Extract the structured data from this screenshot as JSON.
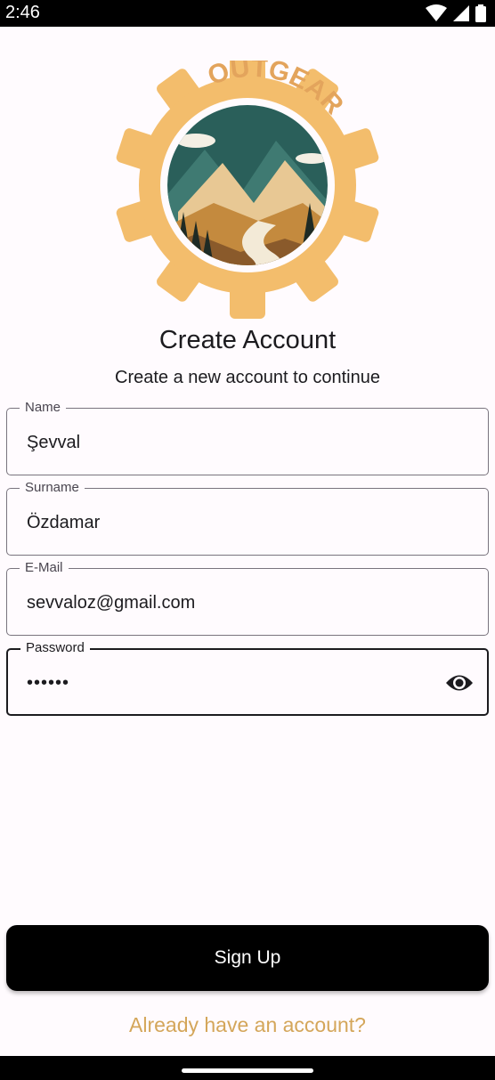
{
  "status_bar": {
    "time": "2:46",
    "icons": [
      "wifi-icon",
      "signal-icon",
      "battery-icon"
    ]
  },
  "logo": {
    "brand": "OUTGEAR",
    "colors": {
      "gear": "#f3bd6c",
      "sky": "#2a5f5a",
      "text": "#e3a45c"
    }
  },
  "header": {
    "title": "Create Account",
    "subtitle": "Create a new account to continue"
  },
  "form": {
    "name": {
      "label": "Name",
      "value": "Şevval"
    },
    "surname": {
      "label": "Surname",
      "value": "Özdamar"
    },
    "email": {
      "label": "E-Mail",
      "value": "sevvaloz@gmail.com"
    },
    "password": {
      "label": "Password",
      "value": "••••••",
      "toggle_icon": "eye-icon"
    }
  },
  "actions": {
    "signup_label": "Sign Up",
    "login_link": "Already have an account?"
  },
  "colors": {
    "accent": "#d4a65a",
    "button": "#000000",
    "background": "#fffbfe"
  }
}
